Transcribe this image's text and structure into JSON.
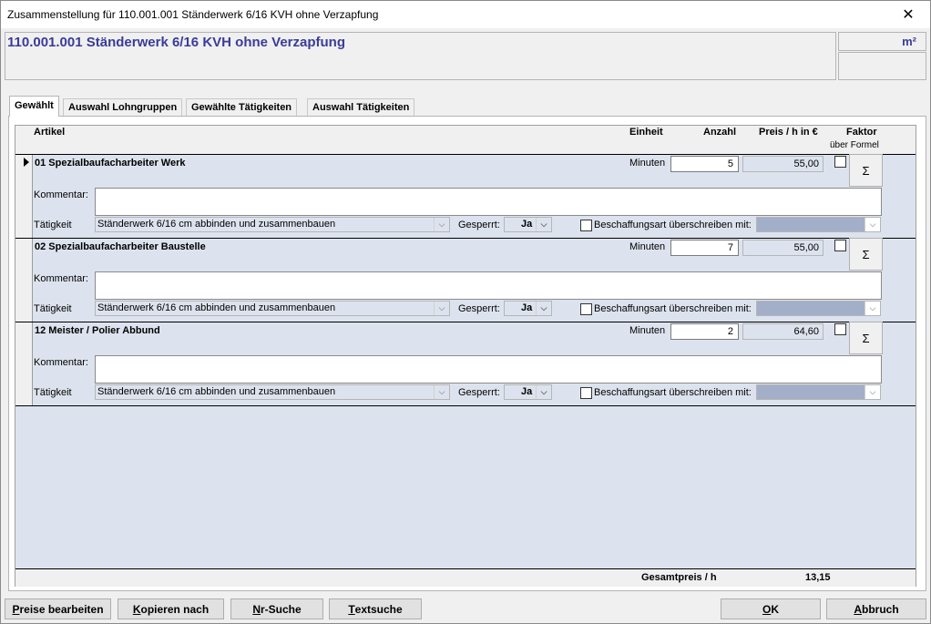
{
  "window": {
    "title": "Zusammenstellung für 110.001.001 Ständerwerk 6/16 KVH ohne Verzapfung",
    "close_glyph": "✕"
  },
  "header": {
    "title": "110.001.001 Ständerwerk 6/16 KVH ohne Verzapfung",
    "unit": "m²"
  },
  "tabs": [
    {
      "label": "Gewählt",
      "active": true
    },
    {
      "label": "Auswahl Lohngruppen",
      "active": false
    },
    {
      "label": "Gewählte Tätigkeiten",
      "active": false
    },
    {
      "label": "Auswahl Tätigkeiten",
      "active": false
    }
  ],
  "grid": {
    "columns": {
      "artikel": "Artikel",
      "einheit": "Einheit",
      "anzahl": "Anzahl",
      "preis": "Preis / h in €",
      "faktor": "Faktor",
      "faktor_sub": "über Formel"
    },
    "labels": {
      "kommentar": "Kommentar:",
      "taetigkeit": "Tätigkeit",
      "gesperrt": "Gesperrt:",
      "beschaffung": "Beschaffungsart überschreiben mit:",
      "sigma": "Σ",
      "chevron": "⌵"
    },
    "records": [
      {
        "title": "01  Spezialbaufacharbeiter Werk",
        "einheit": "Minuten",
        "anzahl": "5",
        "preis": "55,00",
        "kommentar": "",
        "taetigkeit": "Ständerwerk 6/16 cm abbinden und zusammenbauen",
        "gesperrt": "Ja"
      },
      {
        "title": "02  Spezialbaufacharbeiter Baustelle",
        "einheit": "Minuten",
        "anzahl": "7",
        "preis": "55,00",
        "kommentar": "",
        "taetigkeit": "Ständerwerk 6/16 cm abbinden und zusammenbauen",
        "gesperrt": "Ja"
      },
      {
        "title": "12  Meister / Polier Abbund",
        "einheit": "Minuten",
        "anzahl": "2",
        "preis": "64,60",
        "kommentar": "",
        "taetigkeit": "Ständerwerk 6/16 cm abbinden und zusammenbauen",
        "gesperrt": "Ja"
      }
    ]
  },
  "footer": {
    "label": "Gesamtpreis / h",
    "value": "13,15"
  },
  "buttons": {
    "preise": {
      "ul": "P",
      "rest": "reise bearbeiten"
    },
    "kopieren": {
      "ul": "K",
      "rest": "opieren nach"
    },
    "nrsuche": {
      "ul": "N",
      "rest": "r-Suche"
    },
    "textsuche": {
      "ul": "T",
      "rest": "extsuche"
    },
    "ok": {
      "ul": "O",
      "rest": "K"
    },
    "abbruch": {
      "ul": "A",
      "rest": "bbruch"
    }
  }
}
